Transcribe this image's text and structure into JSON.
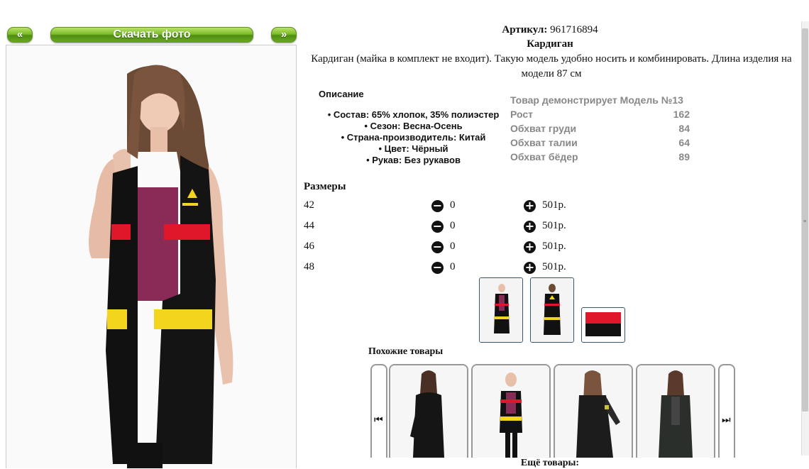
{
  "nav": {
    "prev_label": "«",
    "download_label": "Скачать фото",
    "next_label": "»"
  },
  "product": {
    "article_label": "Артикул:",
    "article_value": "961716894",
    "title": "Кардиган",
    "description": "Кардиган (майка в комплект не входит). Такую модель удобно носить и комбинировать. Длина изделия на модели 87 см"
  },
  "description_section": {
    "heading": "Описание",
    "attributes": [
      "• Состав: 65% хлопок, 35% полиэстер",
      "• Сезон: Весна-Осень",
      "• Страна-производитель: Китай",
      "• Цвет: Чёрный",
      "• Рукав: Без рукавов"
    ]
  },
  "model": {
    "heading": "Товар демонстрирует Модель №13",
    "rows": [
      {
        "label": "Рост",
        "value": "162"
      },
      {
        "label": "Обхват груди",
        "value": "84"
      },
      {
        "label": "Обхват талии",
        "value": "64"
      },
      {
        "label": "Обхват бёдер",
        "value": "89"
      }
    ]
  },
  "sizes": {
    "heading": "Размеры",
    "rows": [
      {
        "size": "42",
        "qty": "0",
        "price": "501р."
      },
      {
        "size": "44",
        "qty": "0",
        "price": "501р."
      },
      {
        "size": "46",
        "qty": "0",
        "price": "501р."
      },
      {
        "size": "48",
        "qty": "0",
        "price": "501р."
      }
    ]
  },
  "similar": {
    "heading": "Похожие товары"
  },
  "more": {
    "heading": "Ещё товары:"
  },
  "colors": {
    "button_green": "#6aa820",
    "vest_black": "#111111",
    "stripe_red": "#e0162b",
    "stripe_yellow": "#f2d51c",
    "top_magenta": "#8a2a56"
  }
}
